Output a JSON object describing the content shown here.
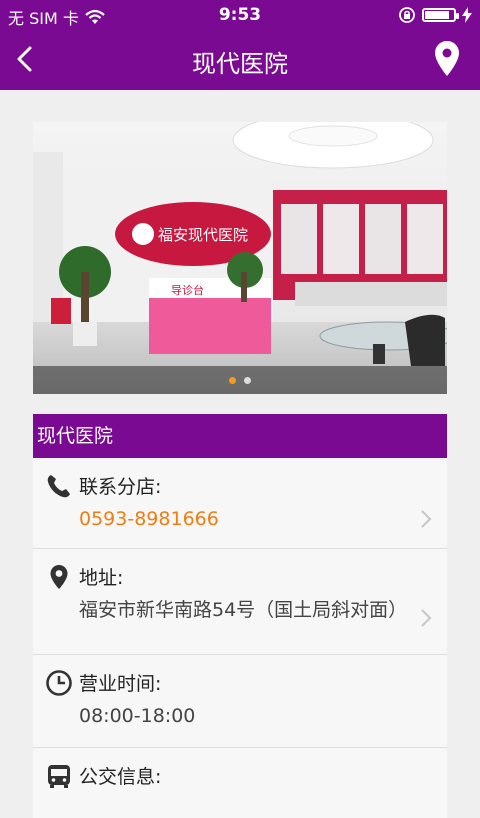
{
  "status_bar": {
    "carrier": "无 SIM 卡",
    "time": "9:53"
  },
  "nav": {
    "title": "现代医院"
  },
  "banner": {
    "sign_text": "福安现代医院",
    "desk_text": "导诊台",
    "dot_count": 2,
    "active_dot": 0
  },
  "card": {
    "title": "现代医院",
    "rows": [
      {
        "icon": "phone-icon",
        "label": "联系分店:",
        "value": "0593-8981666",
        "value_color": "#f07d12",
        "has_chevron": true
      },
      {
        "icon": "location-pin-icon",
        "label": "地址:",
        "value": "福安市新华南路54号（国土局斜对面）",
        "has_chevron": true
      },
      {
        "icon": "clock-icon",
        "label": "营业时间:",
        "value": "08:00-18:00",
        "has_chevron": false
      },
      {
        "icon": "bus-icon",
        "label": "公交信息:",
        "value": "",
        "has_chevron": false
      }
    ]
  },
  "colors": {
    "brand": "#7b0a93",
    "accent": "#f07d12",
    "background": "#efefef"
  }
}
